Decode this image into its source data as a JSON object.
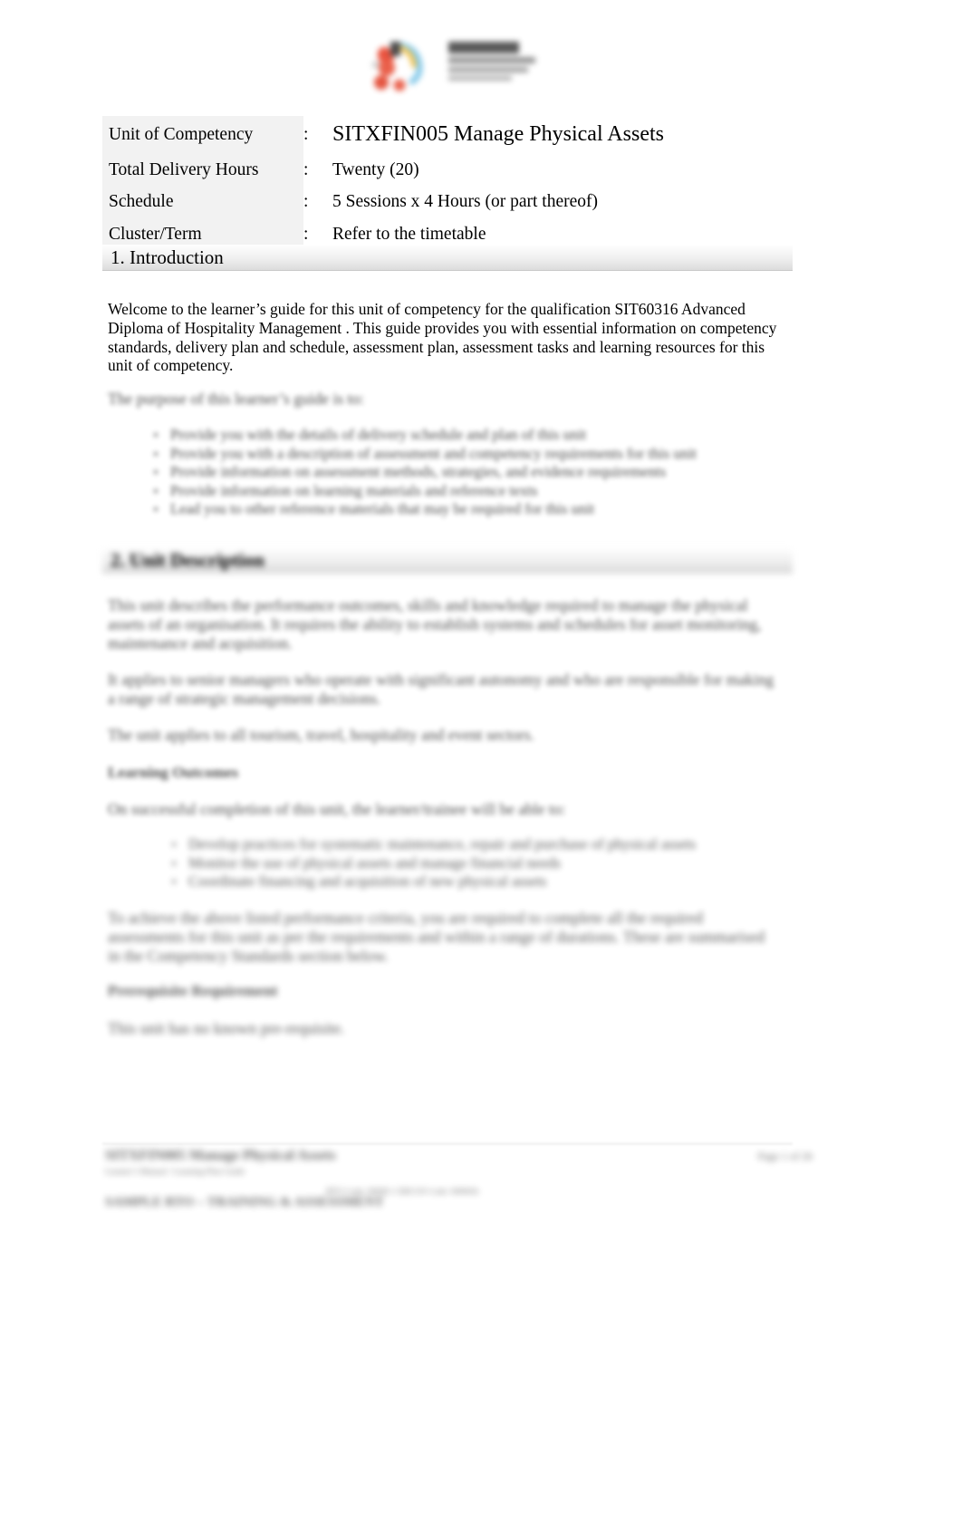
{
  "document": {
    "logo": {
      "icon": "institute-logo",
      "alt_lines": [
        "",
        "",
        "",
        ""
      ]
    },
    "header_table": {
      "rows": [
        {
          "label": "Unit of Competency",
          "separator": ":",
          "value": "SITXFIN005 Manage Physical Assets"
        },
        {
          "label": "Total Delivery Hours",
          "separator": ":",
          "value": "Twenty (20)"
        },
        {
          "label": "Schedule",
          "separator": ":",
          "value": "5 Sessions x 4 Hours (or part thereof)"
        },
        {
          "label": "Cluster/Term",
          "separator": ":",
          "value": "Refer to the timetable"
        }
      ]
    },
    "section_1": {
      "heading": "1. Introduction",
      "paragraph": "Welcome to the learner’s guide for this unit of competency for the qualification   SIT60316 Advanced Diploma of Hospitality Management . This guide provides you with essential information on competency standards, delivery plan and schedule, assessment plan, assessment tasks and learning resources for this unit of competency.",
      "lead_in": "The purpose of this learner’s guide is to:",
      "bullets": [
        "Provide you with the details of delivery schedule and plan of this unit",
        "Provide you with a description of assessment and competency requirements for this unit",
        "Provide information on assessment methods, strategies, and evidence requirements",
        "Provide information on learning materials and reference texts",
        "Lead you to other reference materials that may be required for this unit"
      ]
    },
    "section_2": {
      "heading": "2. Unit Description",
      "paragraph_1": "This unit describes the performance outcomes, skills and knowledge required to manage the physical assets of an organisation. It requires the ability to establish systems and schedules for asset monitoring, maintenance and acquisition.",
      "paragraph_2": "It applies to senior managers who operate with significant autonomy and who are responsible for making a range of strategic management decisions.",
      "paragraph_3": "The unit applies to all tourism, travel, hospitality and event sectors.",
      "learning_outcomes_heading": "Learning Outcomes",
      "learning_outcomes_intro": "On successful completion of this unit, the learner/trainee will be able to:",
      "learning_outcomes": [
        "Develop practices for systematic maintenance, repair and purchase of physical assets",
        "Monitor the use of physical assets and manage financial needs",
        "Coordinate financing and acquisition of new physical assets"
      ],
      "paragraph_4": "To achieve the above listed performance criteria, you are required to complete all the required assessments for this unit as per the requirements and within a range of durations. These are summarised in the Competency Standards section below.",
      "prerequisite_heading": "Prerequisite Requirement",
      "prerequisite_text": "This unit has no known pre-requisite."
    },
    "footer": {
      "title": "SITXFIN005 Manage Physical Assets",
      "subtitle": "Learner’s Manual / Learning Plan Guide",
      "provider": "SAMPLE RTO – TRAINING & ASSESSMENT",
      "provider_note": "RTO Code: 00000 | CRICOS Code: 00000A",
      "page_number": "Page 1 of 26"
    }
  }
}
